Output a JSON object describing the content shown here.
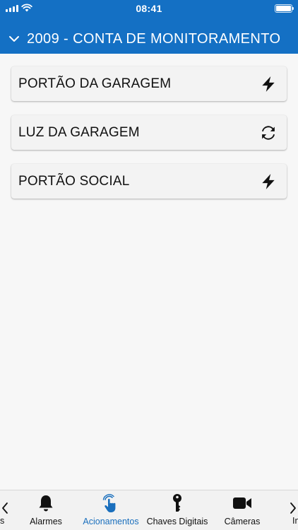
{
  "colors": {
    "brand": "#1470c4",
    "active_tab": "#1a6fbd",
    "card_background": "#f3f3f3",
    "page_background": "#f7f7f7"
  },
  "status_bar": {
    "time": "08:41",
    "icons": [
      "signal-icon",
      "wifi-icon",
      "battery-icon"
    ]
  },
  "header": {
    "toggle_icon": "chevron-down-icon",
    "title": "2009 - CONTA DE MONITORAMENTO"
  },
  "actions": [
    {
      "label": "PORTÃO DA GARAGEM",
      "icon": "lightning-icon"
    },
    {
      "label": "LUZ DA GARAGEM",
      "icon": "refresh-icon"
    },
    {
      "label": "PORTÃO SOCIAL",
      "icon": "lightning-icon"
    }
  ],
  "tab_bar": {
    "left_partial_label": "s",
    "right_partial_label": "In",
    "tabs": [
      {
        "label": "Alarmes",
        "icon": "bell-icon",
        "active": false
      },
      {
        "label": "Acionamentos",
        "icon": "hand-tap-icon",
        "active": true
      },
      {
        "label": "Chaves Digitais",
        "icon": "key-icon",
        "active": false
      },
      {
        "label": "Câmeras",
        "icon": "video-camera-icon",
        "active": false
      }
    ]
  }
}
